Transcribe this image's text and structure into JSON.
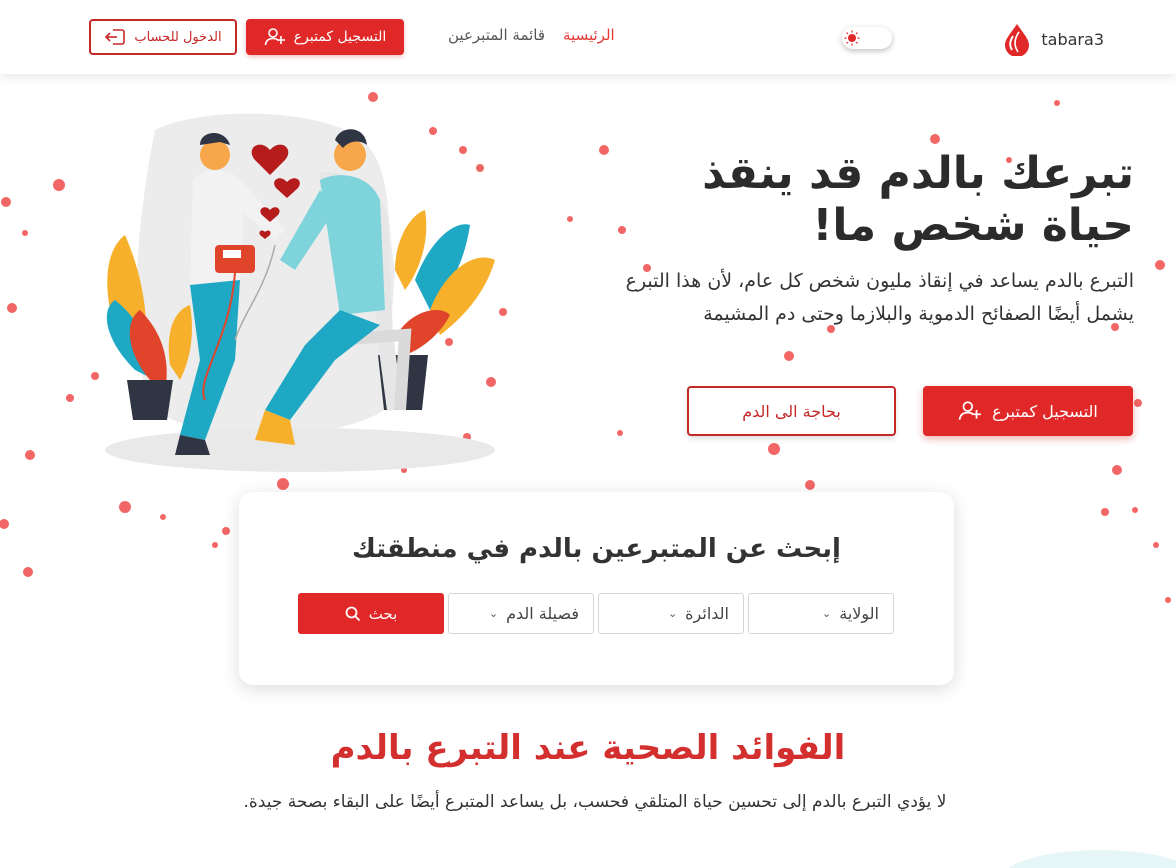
{
  "brand": {
    "name": "tabara3",
    "logo_icon": "blood-drop-icon",
    "color": "#e02828"
  },
  "theme_toggle": {
    "icon": "sun-icon",
    "state": "light"
  },
  "nav": {
    "links": [
      {
        "label": "الرئيسية",
        "active": true
      },
      {
        "label": "قائمة المتبرعين",
        "active": false
      }
    ],
    "register_label": "التسجيل كمتبرع",
    "register_icon": "user-plus-icon",
    "login_label": "الدخول للحساب",
    "login_icon": "sign-in-icon"
  },
  "hero": {
    "title": "تبرعك بالدم قد ينقذ حياة شخص ما!",
    "text": "التبرع بالدم يساعد في إنقاذ مليون شخص كل عام، لأن هذا التبرع يشمل أيضًا الصفائح الدموية والبلازما وحتى دم المشيمة",
    "register_label": "التسجيل كمتبرع",
    "need_blood_label": "بحاجة الى الدم",
    "illustration": "blood-donation-illustration"
  },
  "search": {
    "title": "إبحث عن المتبرعين بالدم في منطقتك",
    "state_select": "الولاية",
    "district_select": "الدائرة",
    "blood_type_select": "فصيلة الدم",
    "search_label": "بحث",
    "search_icon": "search-icon"
  },
  "benefits": {
    "title": "الفوائد الصحية عند التبرع بالدم",
    "text": "لا يؤدي التبرع بالدم إلى تحسين حياة المتلقي فحسب، بل يساعد المتبرع أيضًا على البقاء بصحة جيدة."
  },
  "colors": {
    "accent": "#e02828",
    "title_red": "#d32f2f",
    "dots": "#f04b4b"
  }
}
